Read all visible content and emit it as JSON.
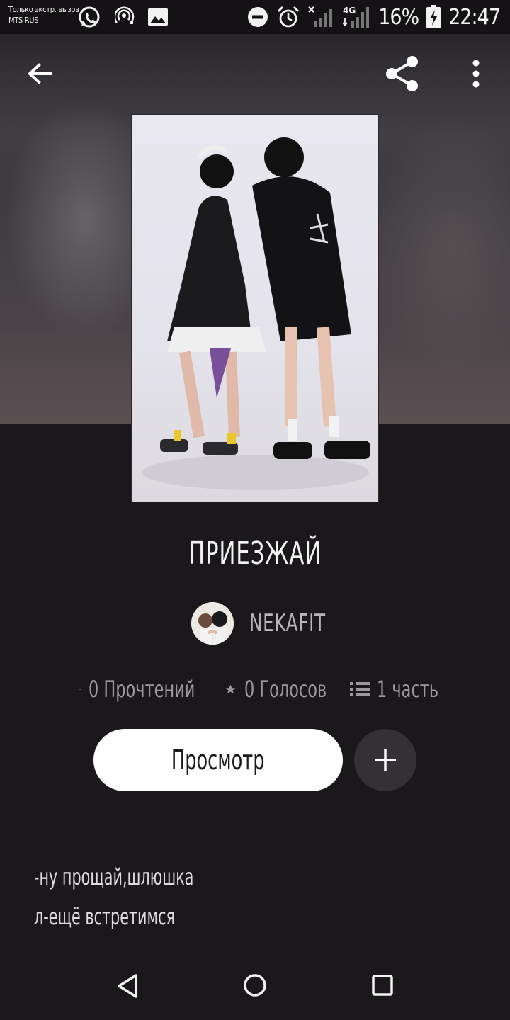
{
  "status_bar": {
    "carrier_line1": "Только экстр. вызов",
    "carrier_line2": "MTS RUS",
    "network_type": "4G",
    "battery_percent": "16%",
    "time": "22:47",
    "icons": [
      "whatsapp-icon",
      "hotspot-icon",
      "image-icon",
      "dnd-icon",
      "alarm-icon",
      "no-signal-icon",
      "signal-icon",
      "battery-icon"
    ]
  },
  "toolbar": {
    "back_icon": "arrow-left-icon",
    "share_icon": "share-icon",
    "more_icon": "more-vertical-icon"
  },
  "story": {
    "title": "ПРИЕЗЖАЙ",
    "author": "NEKAFIT",
    "stats": {
      "reads": "0 Прочтений",
      "votes": "0 Голосов",
      "parts": "1 часть"
    },
    "read_button": "Просмотр",
    "add_button_icon": "plus-icon",
    "description_lines": [
      "-ну прощай,шлюшка",
      "л-ещё встретимся"
    ]
  },
  "navigation": {
    "back": "triangle-back-icon",
    "home": "circle-home-icon",
    "recents": "square-recents-icon"
  }
}
